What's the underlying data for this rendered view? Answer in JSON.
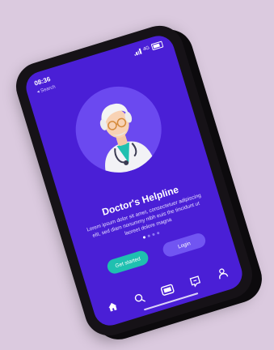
{
  "status_bar": {
    "time": "08:36",
    "network": "4G"
  },
  "back_link": "◂ Search",
  "hero": {
    "title": "Doctor's Helpline",
    "description": "Lorem ipsum dolor sit amet, consectetuer adipiscing elit, sed diam nonummy nibh euis the tincidunt ut laoreet dolore magna"
  },
  "pagination": {
    "count": 4,
    "active_index": 0
  },
  "buttons": {
    "get_started": "Get started",
    "login": "Login"
  },
  "bottom_nav": {
    "items": [
      "home-icon",
      "search-icon",
      "tablet-icon",
      "chat-icon",
      "user-icon"
    ],
    "active": "home-icon"
  },
  "colors": {
    "background": "#dbcadf",
    "device": "#161217",
    "screen": "#4a1fd6",
    "avatar_circle": "#6b49f0",
    "get_started": "#1fc0b0",
    "login": "#7155f2"
  }
}
